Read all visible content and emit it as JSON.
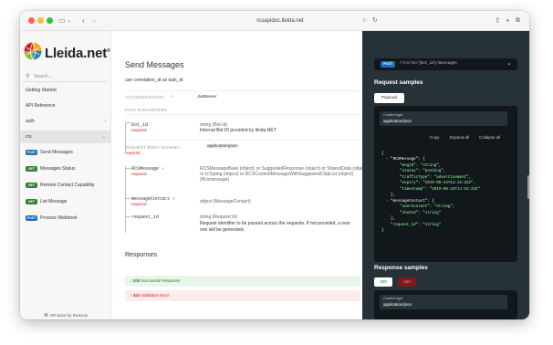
{
  "browser": {
    "url": "rcsapidoc.lleida.net",
    "colors": {
      "close": "#ff5f57",
      "min": "#febc2e",
      "max": "#28c840"
    }
  },
  "sidebar": {
    "logo_text": "Lleida.net",
    "logo_reg": "®",
    "search_placeholder": "Search...",
    "items": [
      {
        "label": "Getting Started"
      },
      {
        "label": "API Reference"
      },
      {
        "label": "auth"
      },
      {
        "label": "rcs"
      }
    ],
    "sub_items": [
      {
        "method": "POST",
        "label": "Send Messages"
      },
      {
        "method": "GET",
        "label": "Messages Status"
      },
      {
        "method": "GET",
        "label": "Remote Contact Capability"
      },
      {
        "method": "GET",
        "label": "List Message"
      },
      {
        "method": "POST",
        "label": "Process Webhook"
      }
    ],
    "footer": "API docs by Redocly"
  },
  "main": {
    "title": "Send Messages",
    "description": "use correlation_id as task_id",
    "authorizations_label": "AUTHORIZATIONS:",
    "authorizations_value": "JwtBearer",
    "path_params_label": "PATH PARAMETERS",
    "bot_id": {
      "name": "bot_id",
      "required": "required",
      "type": "string (Bot Id)",
      "desc": "Internal Bot ID provided by lleida.NET"
    },
    "body_schema_label": "REQUEST BODY SCHEMA:",
    "body_schema_value": "application/json",
    "body_required": "required",
    "rcs_message": {
      "name": "RCSMessage",
      "required": "required",
      "type_line1": "RCSMessageBase (object) or SuggestedResponse (object) or SharedData (object)",
      "type_line2": "or IsTyping (object) or RCSContentMessageWithSuggestedChipList (object)",
      "type_line3": "(Rcsmessage)"
    },
    "message_contact": {
      "name": "messageContact",
      "required": "required",
      "type": "object (MessageContact)"
    },
    "request_id": {
      "name": "request_id",
      "type": "string (Request Id)",
      "desc_line1": "Request identifier to be passed across the requests. If not provided, a new",
      "desc_line2": "one will be generated."
    },
    "responses_title": "Responses",
    "responses": [
      {
        "code": "200",
        "label": "Successful Response",
        "color": "#1d8127",
        "bg": "#eaf5eb"
      },
      {
        "code": "422",
        "label": "Validation Error",
        "color": "#d41f1c",
        "bg": "#fbebeb"
      }
    ]
  },
  "right": {
    "endpoint_method": "POST",
    "endpoint_path": "/rcs/v1/{bot_id}/messages",
    "request_samples_title": "Request samples",
    "payload_tab": "Payload",
    "content_type_label": "Content type",
    "content_type_value": "application/json",
    "copy": "Copy",
    "expand_all": "Expand all",
    "collapse_all": "Collapse all",
    "code_lines": [
      "{",
      "  - \"RCSMessage\": {",
      "        \"msgId\": \"string\",",
      "        \"status\": \"pending\",",
      "        \"trafficType\": \"advertisement\",",
      "        \"expiry\": \"2019-08-24T14:15:22Z\",",
      "        \"timestamp\": \"2019-08-24T14:15:22Z\"",
      "    },",
      "  - \"messageContact\": {",
      "        \"userContact\": \"string\",",
      "        \"chatId\": \"string\"",
      "    },",
      "    \"request_id\": \"string\"",
      "}"
    ],
    "response_samples_title": "Response samples",
    "response_tabs": [
      "200",
      "422"
    ],
    "response_content_type_label": "Content type",
    "response_content_type_value": "application/json"
  }
}
